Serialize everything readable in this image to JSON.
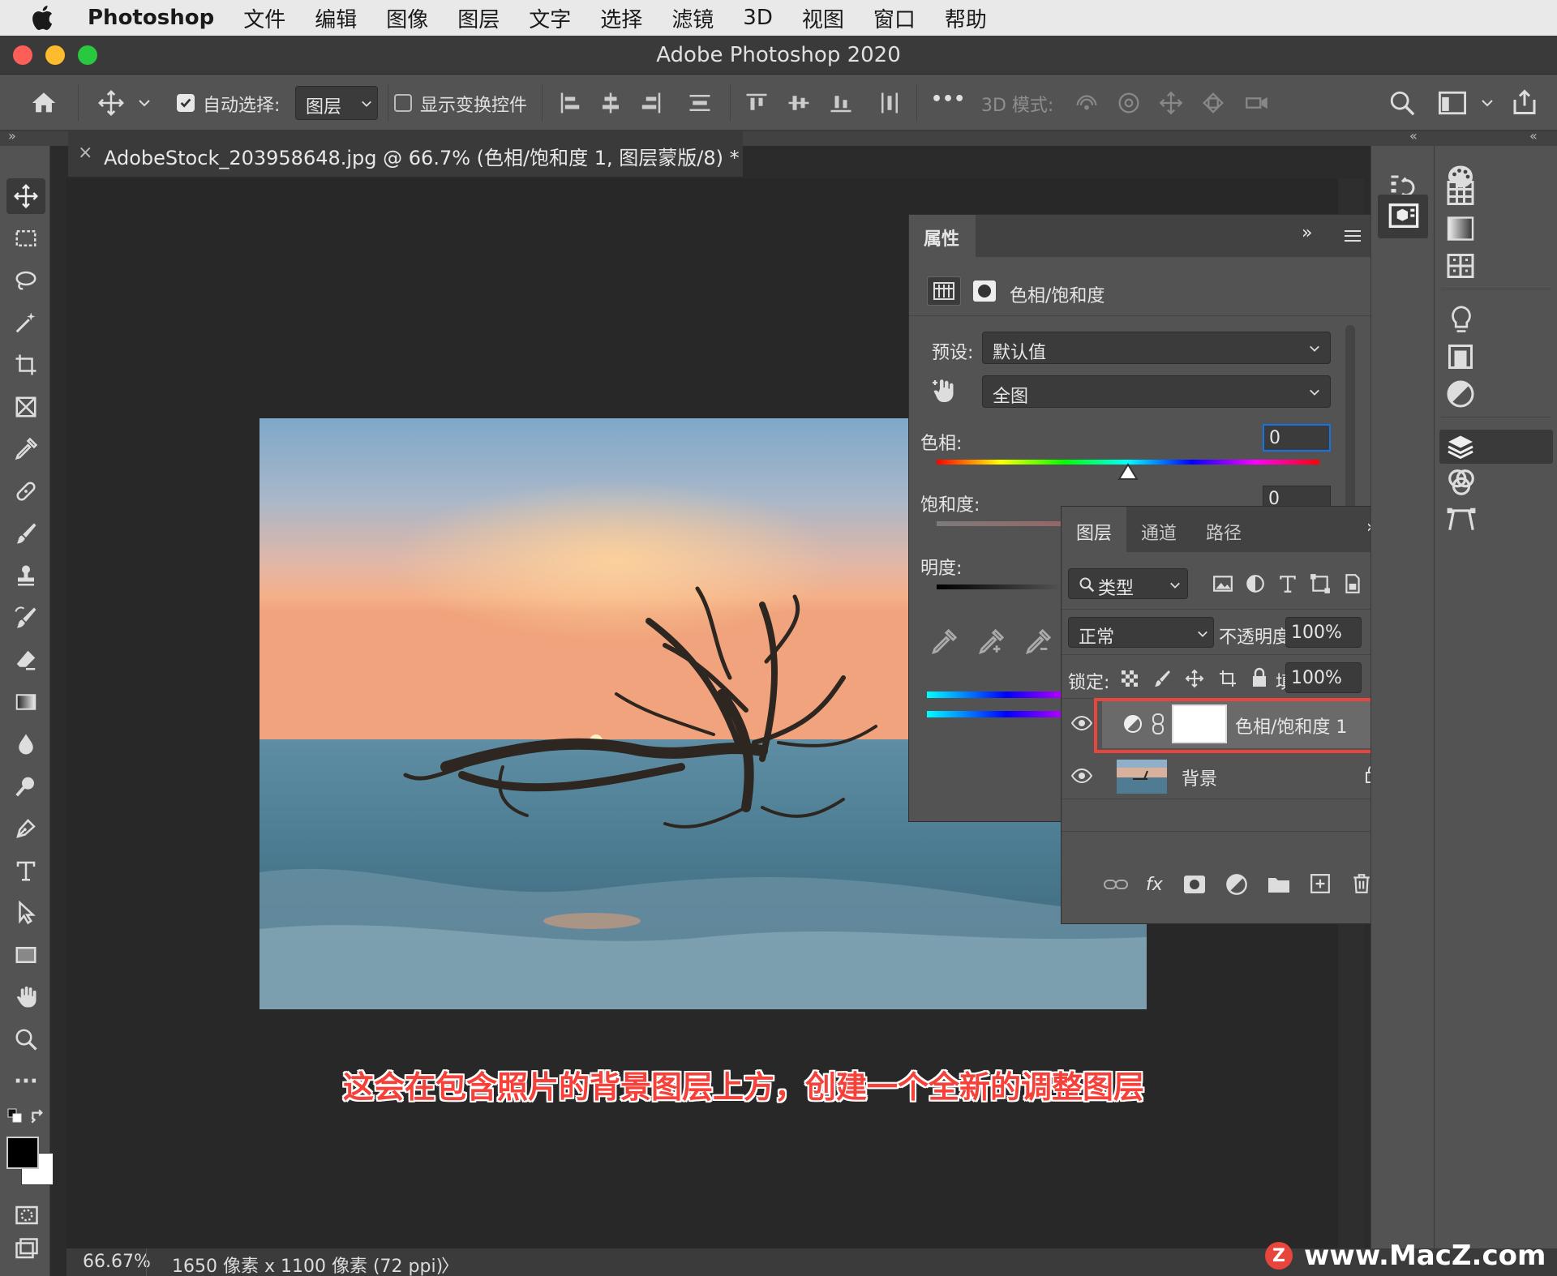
{
  "menubar": {
    "app_name": "Photoshop",
    "items": [
      "文件",
      "编辑",
      "图像",
      "图层",
      "文字",
      "选择",
      "滤镜",
      "3D",
      "视图",
      "窗口",
      "帮助"
    ]
  },
  "window": {
    "title": "Adobe Photoshop 2020"
  },
  "options_bar": {
    "auto_select_label": "自动选择:",
    "auto_select_checked": true,
    "auto_select_target": "图层",
    "show_transform_label": "显示变换控件",
    "show_transform_checked": false,
    "more_label": "•••",
    "mode_3d_label": "3D 模式:"
  },
  "document": {
    "tab_close": "×",
    "tab_title": "AdobeStock_203958648.jpg @ 66.7% (色相/饱和度 1, 图层蒙版/8) *"
  },
  "properties": {
    "tab_label": "属性",
    "type_label": "色相/饱和度",
    "preset_label": "预设:",
    "preset_value": "默认值",
    "channel_value": "全图",
    "hue_label": "色相:",
    "hue_value": "0",
    "saturation_label": "饱和度:",
    "saturation_value": "0",
    "lightness_label": "明度:"
  },
  "layers": {
    "tabs": [
      "图层",
      "通道",
      "路径"
    ],
    "filter_kind": "类型",
    "blend_mode": "正常",
    "opacity_label": "不透明度:",
    "opacity_value": "100%",
    "lock_label": "锁定:",
    "fill_label": "填充:",
    "fill_value": "100%",
    "items": [
      {
        "name": "色相/饱和度 1",
        "visible": true,
        "selected": true
      },
      {
        "name": "背景",
        "visible": true,
        "locked": true
      }
    ],
    "fx_label": "fx"
  },
  "status": {
    "zoom": "66.67%",
    "doc_info": "1650 像素 x 1100 像素 (72 ppi)",
    "arrow": "〉"
  },
  "caption": "这会在包含照片的背景图层上方，创建一个全新的调整图层",
  "watermark": "www.MacZ.com",
  "colors": {
    "highlight": "#e8453c",
    "accent_blue": "#1473e6"
  }
}
